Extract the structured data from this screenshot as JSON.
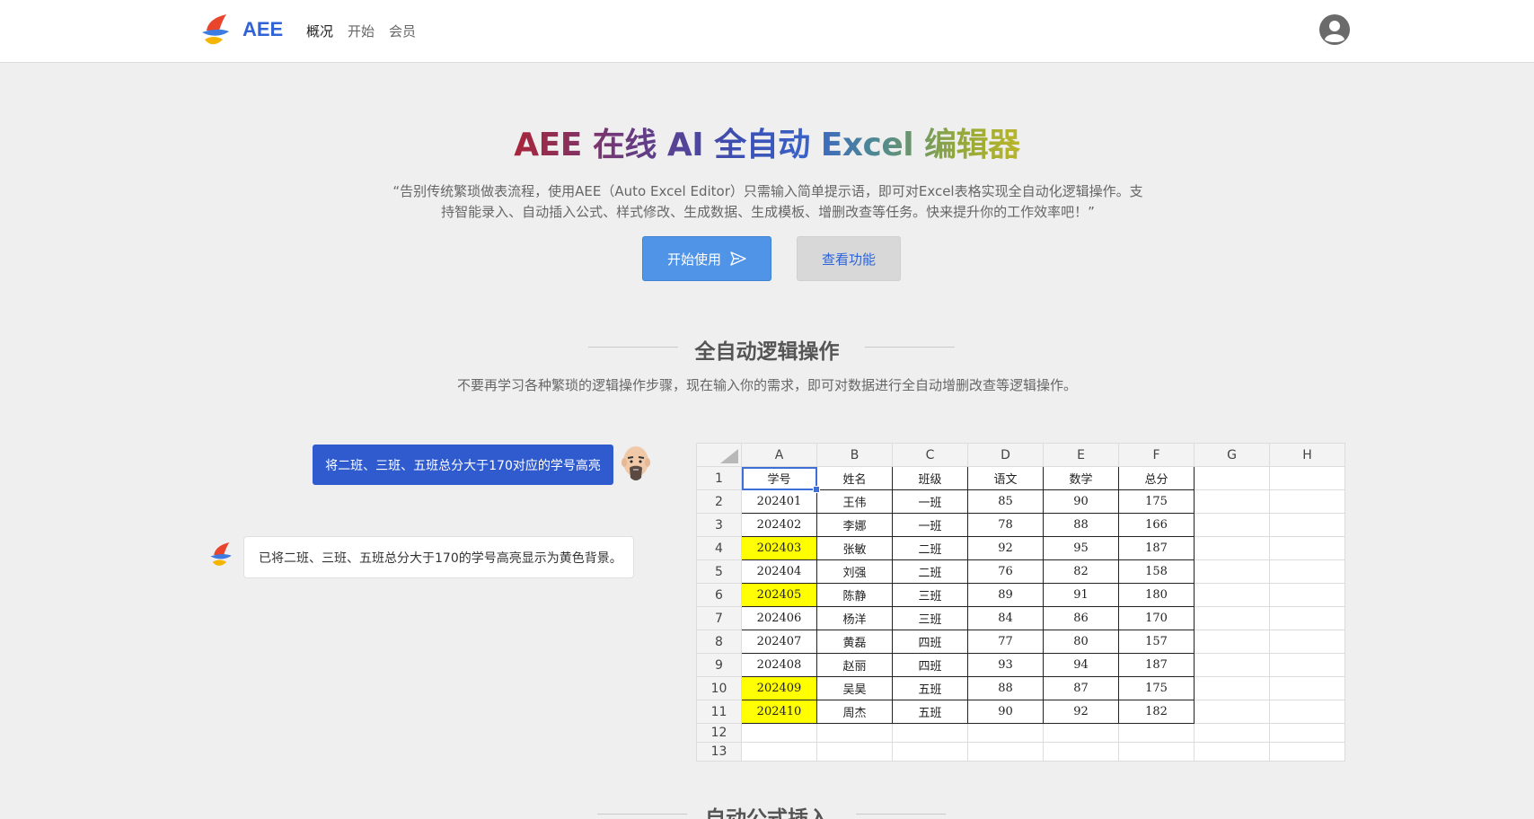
{
  "header": {
    "brand": "AEE",
    "nav": [
      "概况",
      "开始",
      "会员"
    ]
  },
  "hero": {
    "title": "AEE 在线 AI 全自动 Excel 编辑器",
    "description": "“告别传统繁琐做表流程，使用AEE（Auto Excel Editor）只需输入简单提示语，即可对Excel表格实现全自动化逻辑操作。支持智能录入、自动插入公式、样式修改、生成数据、生成模板、增删改查等任务。快来提升你的工作效率吧！”",
    "start_label": "开始使用",
    "features_label": "查看功能"
  },
  "section": {
    "title": "全自动逻辑操作",
    "subtitle": "不要再学习各种繁琐的逻辑操作步骤，现在输入你的需求，即可对数据进行全自动增删改查等逻辑操作。"
  },
  "chat": {
    "user_message": "将二班、三班、五班总分大于170对应的学号高亮",
    "bot_message": "已将二班、三班、五班总分大于170的学号高亮显示为黄色背景。"
  },
  "sheet": {
    "columns": [
      "A",
      "B",
      "C",
      "D",
      "E",
      "F",
      "G",
      "H"
    ],
    "headers": [
      "学号",
      "姓名",
      "班级",
      "语文",
      "数学",
      "总分"
    ],
    "rows": [
      [
        "202401",
        "王伟",
        "一班",
        "85",
        "90",
        "175"
      ],
      [
        "202402",
        "李娜",
        "一班",
        "78",
        "88",
        "166"
      ],
      [
        "202403",
        "张敏",
        "二班",
        "92",
        "95",
        "187"
      ],
      [
        "202404",
        "刘强",
        "二班",
        "76",
        "82",
        "158"
      ],
      [
        "202405",
        "陈静",
        "三班",
        "89",
        "91",
        "180"
      ],
      [
        "202406",
        "杨洋",
        "三班",
        "84",
        "86",
        "170"
      ],
      [
        "202407",
        "黄磊",
        "四班",
        "77",
        "80",
        "157"
      ],
      [
        "202408",
        "赵丽",
        "四班",
        "93",
        "94",
        "187"
      ],
      [
        "202409",
        "吴昊",
        "五班",
        "88",
        "87",
        "175"
      ],
      [
        "202410",
        "周杰",
        "五班",
        "90",
        "92",
        "182"
      ]
    ],
    "row_numbers": [
      "1",
      "2",
      "3",
      "4",
      "5",
      "6",
      "7",
      "8",
      "9",
      "10",
      "11",
      "12",
      "13"
    ],
    "highlight_color": "#ffff00"
  },
  "next_section": {
    "title": "自动公式插入"
  },
  "icons": {
    "logo": "aee-logo-icon",
    "avatar": "user-avatar-icon",
    "send": "send-arrow-icon",
    "user_face": "bald-man-avatar",
    "bot": "aee-bot-icon"
  },
  "colors": {
    "brand": "#2f63d6",
    "primary_button": "#4f94e6",
    "user_bubble": "#2f5bcf"
  }
}
